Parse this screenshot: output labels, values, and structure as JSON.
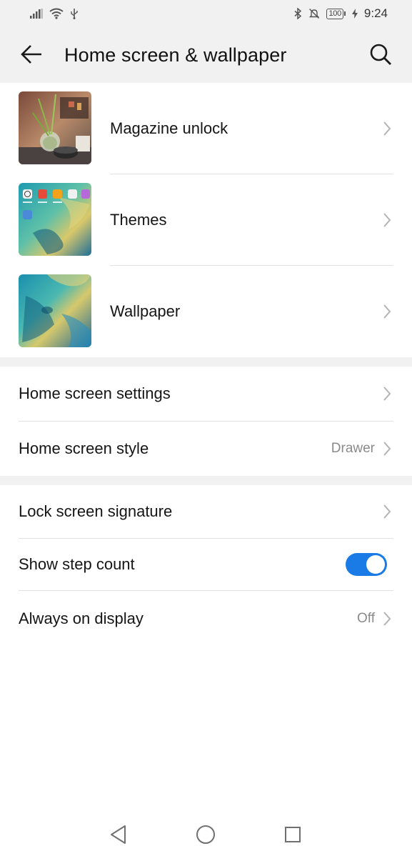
{
  "status_bar": {
    "battery_level": "100",
    "time": "9:24"
  },
  "header": {
    "title": "Home screen & wallpaper"
  },
  "personalization": [
    {
      "label": "Magazine unlock",
      "thumbnail": "magazine-unlock-thumbnail"
    },
    {
      "label": "Themes",
      "thumbnail": "themes-thumbnail"
    },
    {
      "label": "Wallpaper",
      "thumbnail": "wallpaper-thumbnail"
    }
  ],
  "home_screen": {
    "settings_label": "Home screen settings",
    "style_label": "Home screen style",
    "style_value": "Drawer"
  },
  "lock_screen": {
    "signature_label": "Lock screen signature",
    "step_count_label": "Show step count",
    "step_count_enabled": true,
    "aod_label": "Always on display",
    "aod_value": "Off"
  },
  "colors": {
    "accent": "#1a7ae6",
    "background": "#ffffff",
    "header_background": "#f1f1f1",
    "secondary_text": "#8a8a8a"
  }
}
